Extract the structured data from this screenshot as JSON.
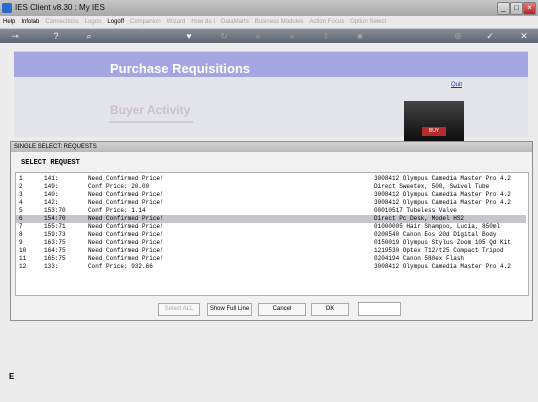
{
  "window": {
    "title": "IES Client v8.30 : My IES",
    "minimize": "_",
    "maximize": "□",
    "close": "×"
  },
  "menu": [
    {
      "label": "Help",
      "enabled": true
    },
    {
      "label": "Infolab",
      "enabled": true
    },
    {
      "label": "Connections",
      "enabled": false
    },
    {
      "label": "Logon",
      "enabled": false
    },
    {
      "label": "Logoff",
      "enabled": true
    },
    {
      "label": "Companion",
      "enabled": false
    },
    {
      "label": "Wizard",
      "enabled": false
    },
    {
      "label": "How do I",
      "enabled": false
    },
    {
      "label": "DataMarts",
      "enabled": false
    },
    {
      "label": "Business Modules",
      "enabled": false
    },
    {
      "label": "Action Focus",
      "enabled": false
    },
    {
      "label": "Option Select",
      "enabled": false
    }
  ],
  "toolbar": {
    "icons": [
      "key-icon",
      "help-icon",
      "search-icon",
      "heart-icon",
      "refresh-icon",
      "rewind-icon",
      "forward-icon",
      "upload-icon",
      "stop-icon",
      "globe-icon",
      "check-icon",
      "close-icon"
    ],
    "glyphs": [
      "⊸",
      "?",
      "⌕",
      "♥",
      "↻",
      "«",
      "»",
      "⇧",
      "■",
      "⊕",
      "✓",
      "✕"
    ]
  },
  "page": {
    "title": "Purchase Requisitions",
    "quit": "Quit",
    "subtitle": "Buyer Activity",
    "keyboard_key": "BUY"
  },
  "dialog": {
    "title": "SINGLE SELECT: REQUESTS",
    "header": "SELECT REQUEST",
    "rows": [
      {
        "num": "1",
        "code": "141:",
        "status": "Need Confirmed Price!",
        "desc": "3008412 Olympus Camedia Master Pro 4.2",
        "selected": false
      },
      {
        "num": "2",
        "code": "149:",
        "status": "Conf Price: 20.00",
        "desc": "Direct Sweetex, 500, Swivel Tube",
        "selected": false
      },
      {
        "num": "3",
        "code": "140:",
        "status": "Need Confirmed Price!",
        "desc": "3008412 Olympus Camedia Master Pro 4.2",
        "selected": false
      },
      {
        "num": "4",
        "code": "142:",
        "status": "Need Confirmed Price!",
        "desc": "3008412 Olympus Camedia Master Pro 4.2",
        "selected": false
      },
      {
        "num": "5",
        "code": "153:70",
        "status": "Conf Price: 1.14",
        "desc": "00010517 Tubeless Valve",
        "selected": false
      },
      {
        "num": "6",
        "code": "154:70",
        "status": "Need Confirmed Price!",
        "desc": "Direct Pc Desk, Model HS2",
        "selected": true
      },
      {
        "num": "7",
        "code": "155:71",
        "status": "Need Confirmed Price!",
        "desc": "01000005 Hair Shampoo, Lucia, 850ml",
        "selected": false
      },
      {
        "num": "8",
        "code": "159:73",
        "status": "Need Confirmed Price!",
        "desc": "0200540 Canon Eos 20d Digital Body",
        "selected": false
      },
      {
        "num": "9",
        "code": "163:75",
        "status": "Need Confirmed Price!",
        "desc": "0150019 Olympus Stylus Zoom 105 Qd Kit",
        "selected": false
      },
      {
        "num": "10",
        "code": "164:75",
        "status": "Need Confirmed Price!",
        "desc": "1219530 Optex T12/t25 Compact Tripod",
        "selected": false
      },
      {
        "num": "11",
        "code": "165:75",
        "status": "Need Confirmed Price!",
        "desc": "0204194 Canon 580ex Flash",
        "selected": false
      },
      {
        "num": "12",
        "code": "133:",
        "status": "Conf Price: 932.66",
        "desc": "3008412 Olympus Camedia Master Pro 4.2",
        "selected": false
      }
    ],
    "buttons": {
      "select_all": "Select ALL",
      "show_full_line": "Show Full Line",
      "cancel": "Cancel",
      "ok": "OK"
    },
    "input_value": ""
  },
  "left_label": "E"
}
